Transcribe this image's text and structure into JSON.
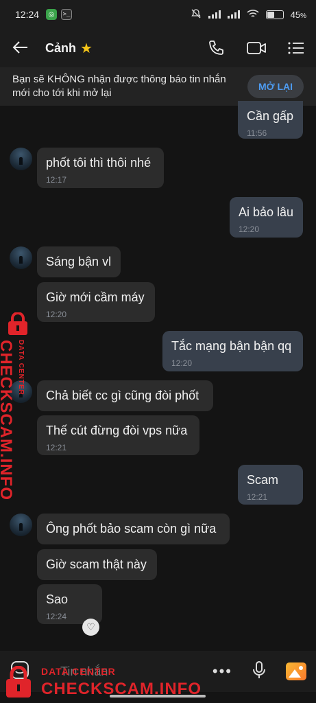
{
  "status": {
    "time": "12:24",
    "battery": "45",
    "battery_unit": "%",
    "battery_level": 0.45
  },
  "header": {
    "contact_name": "Cảnh",
    "star_glyph": "★"
  },
  "notice": {
    "text": "Bạn sẽ KHÔNG nhận được thông báo tin nhắn mới cho tới khi mở lại",
    "button": "MỞ LẠI"
  },
  "messages": [
    {
      "dir": "out",
      "text": "Cần gấp",
      "time": "11:56"
    },
    {
      "dir": "in",
      "text": "phốt tôi thì thôi nhé",
      "time": "12:17"
    },
    {
      "dir": "out",
      "text": "Ai bảo lâu",
      "time": "12:20"
    },
    {
      "dir": "in",
      "text": "Sáng bận vl",
      "time": ""
    },
    {
      "dir": "in",
      "text": "Giờ mới cầm máy",
      "time": "12:20"
    },
    {
      "dir": "out",
      "text": "Tắc mạng bận bận qq",
      "time": "12:20"
    },
    {
      "dir": "in",
      "text": "Chả biết cc gì cũng đòi phốt",
      "time": ""
    },
    {
      "dir": "in",
      "text": "Thế cút đừng đòi vps nữa",
      "time": "12:21"
    },
    {
      "dir": "out",
      "text": "Scam",
      "time": "12:21"
    },
    {
      "dir": "in",
      "text": "Ông phốt bảo scam còn gì nữa",
      "time": ""
    },
    {
      "dir": "in",
      "text": "Giờ scam thật này",
      "time": ""
    },
    {
      "dir": "in",
      "text": "Sao",
      "time": "12:24"
    }
  ],
  "input": {
    "placeholder": "Tin nhắn"
  },
  "watermark": {
    "small": "DATA CENTER",
    "big": "CHECKSCAM.INFO"
  },
  "colors": {
    "accent": "#4d9bf0",
    "outgoing_bubble": "#38404c",
    "incoming_bubble": "#2c2c2c",
    "watermark": "#e0242a"
  }
}
